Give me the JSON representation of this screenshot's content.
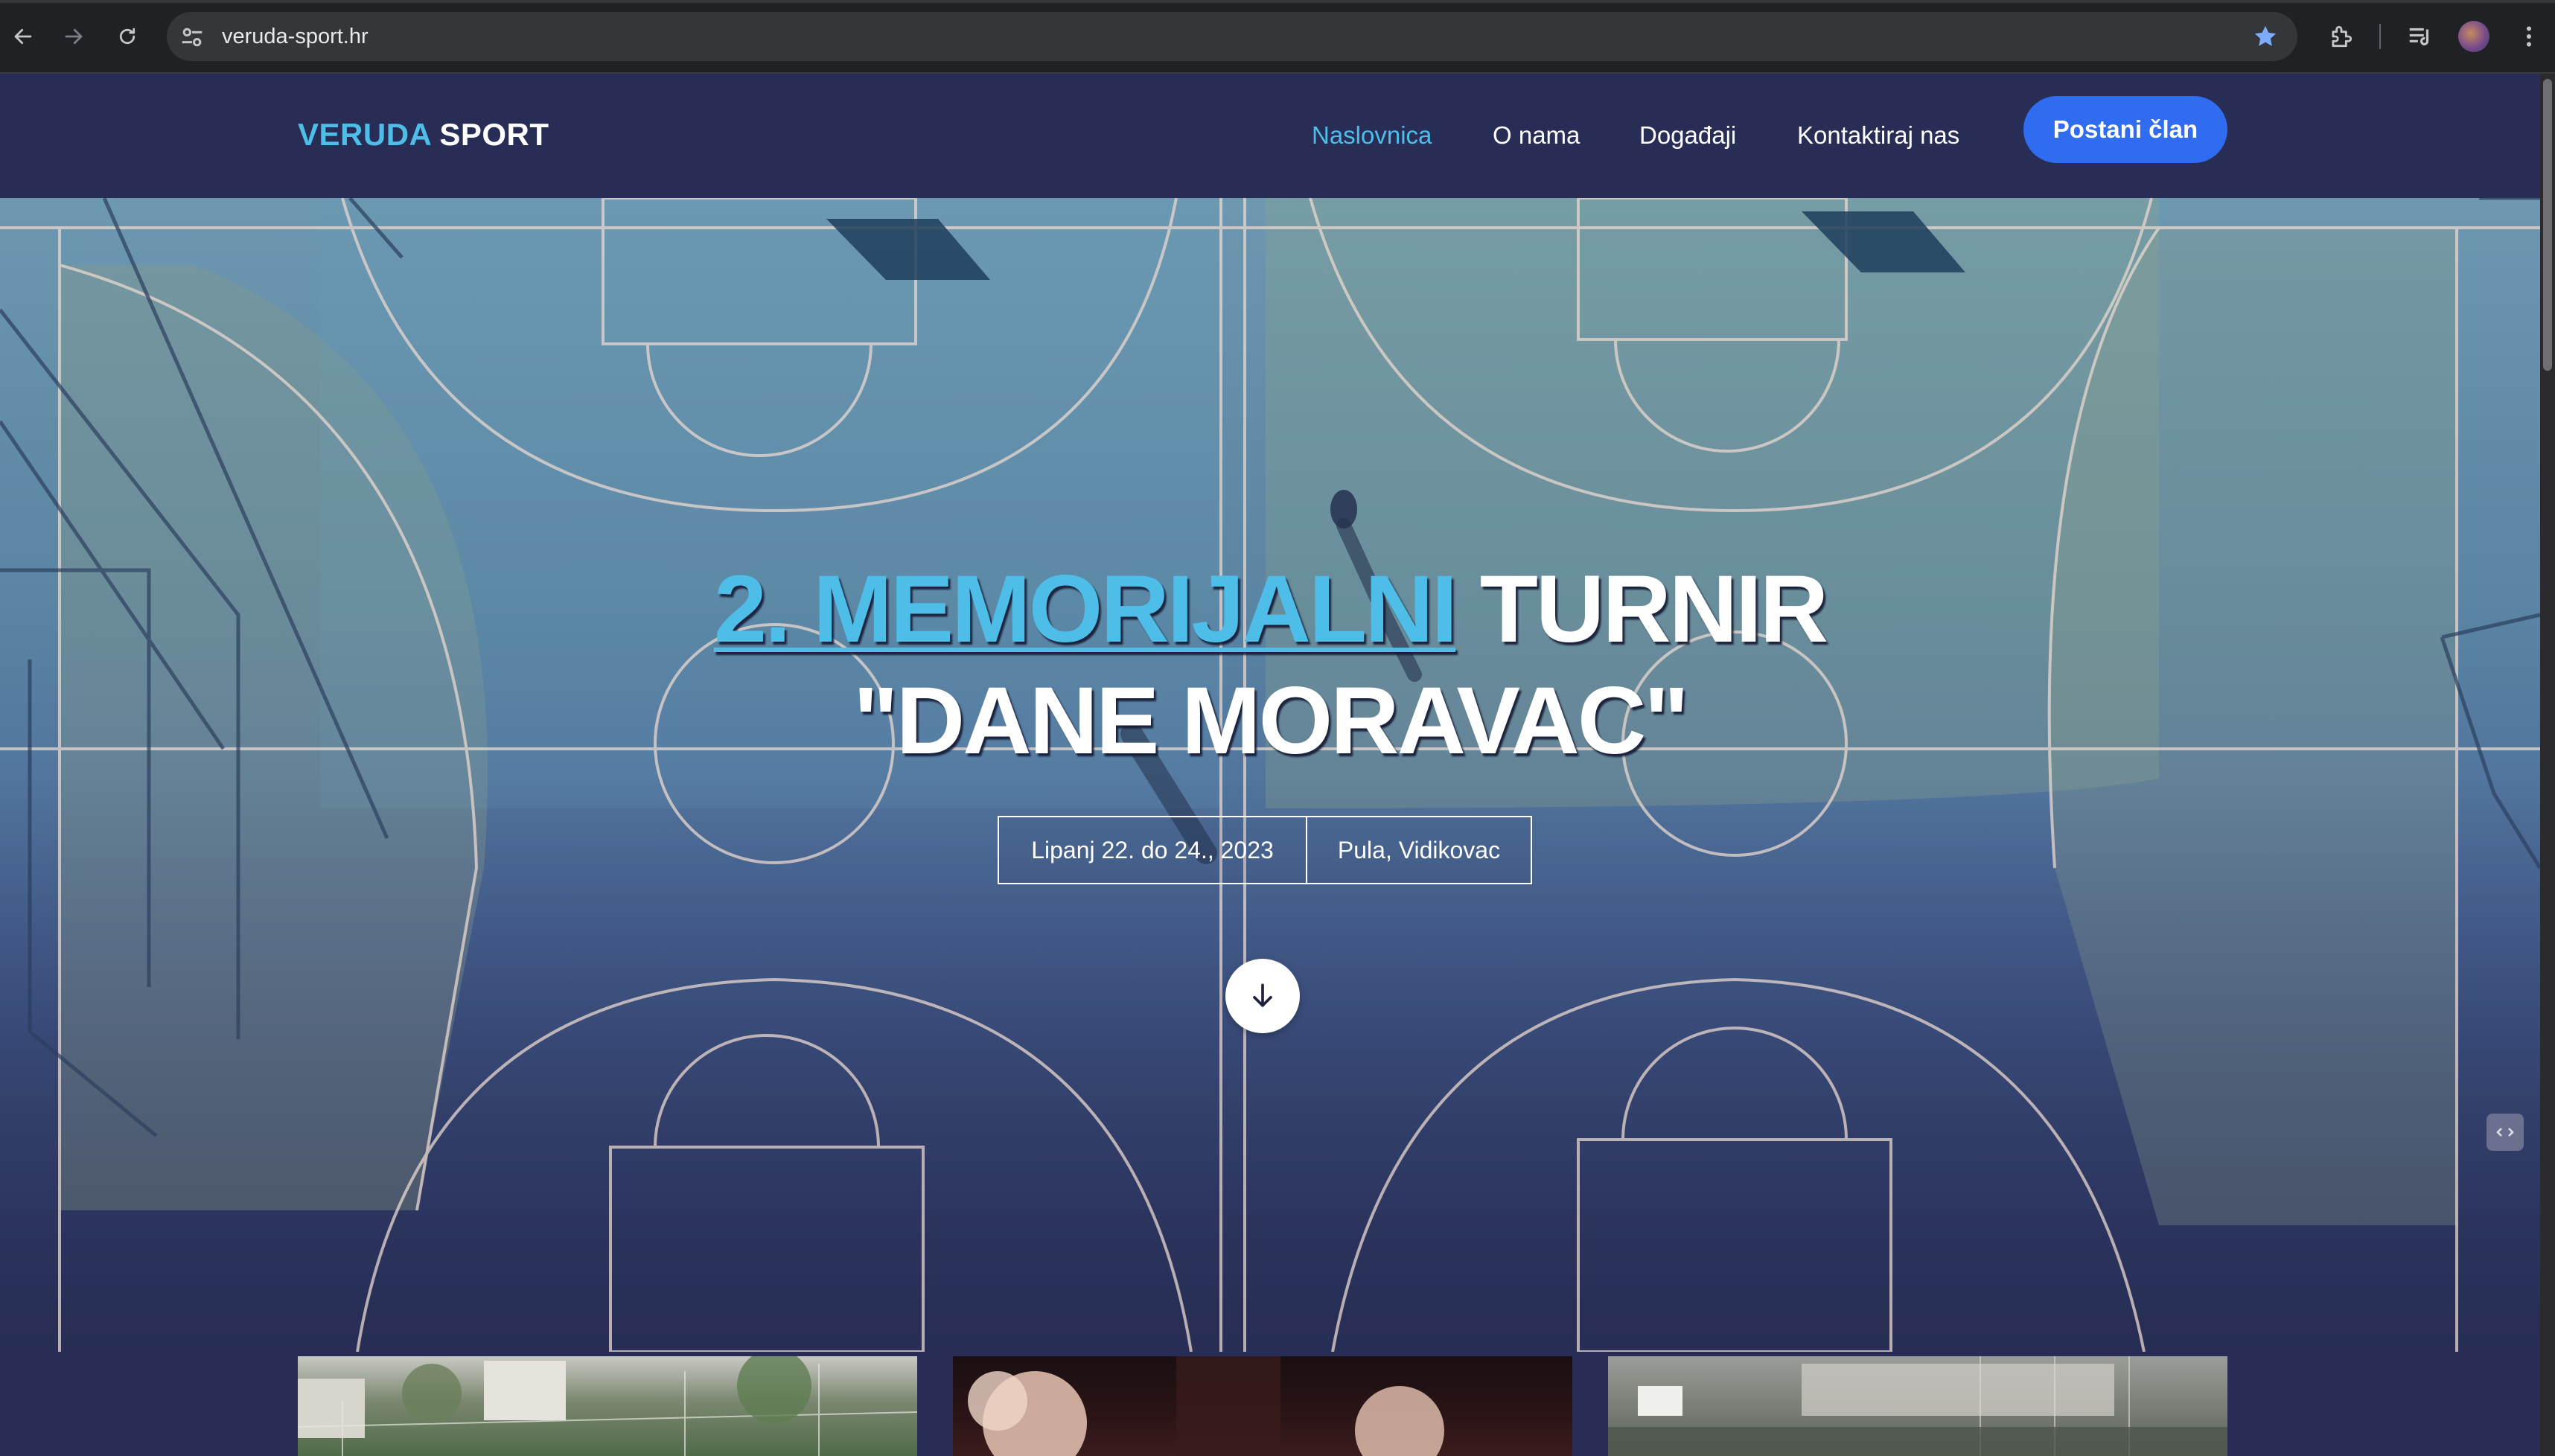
{
  "browser": {
    "url": "veruda-sport.hr",
    "bookmark_starred": true
  },
  "site": {
    "logo": {
      "part1": "VERUDA",
      "part2": "SPORT"
    },
    "nav": [
      {
        "label": "Naslovnica",
        "active": true
      },
      {
        "label": "O nama",
        "active": false
      },
      {
        "label": "Događaji",
        "active": false
      },
      {
        "label": "Kontaktiraj nas",
        "active": false
      }
    ],
    "cta_label": "Postani član"
  },
  "hero": {
    "title_highlight": "2. MEMORIJALNI",
    "title_rest": "TURNIR",
    "title_line2": "\"DANE MORAVAC\"",
    "date": "Lipanj 22. do 24., 2023",
    "location": "Pula, Vidikovac"
  },
  "colors": {
    "accent": "#4ebee9",
    "button": "#2f6cf0",
    "background": "#272d54"
  },
  "icons": {
    "back": "arrow-left-icon",
    "forward": "arrow-right-icon",
    "reload": "reload-icon",
    "site_info": "tune-icon",
    "bookmark": "star-icon",
    "extensions": "puzzle-icon",
    "media": "media-queue-icon",
    "profile": "avatar",
    "menu": "kebab-menu-icon",
    "scroll": "arrow-down-icon"
  }
}
